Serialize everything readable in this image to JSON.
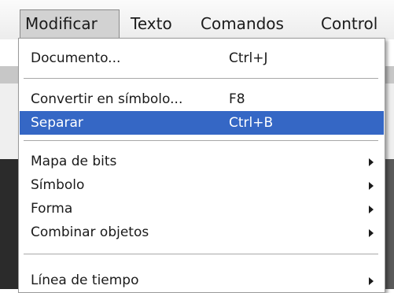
{
  "menubar": {
    "items": [
      {
        "label": "Modificar"
      },
      {
        "label": "Texto"
      },
      {
        "label": "Comandos"
      },
      {
        "label": "Control"
      }
    ]
  },
  "dropdown": {
    "items": [
      {
        "label": "Documento...",
        "shortcut": "Ctrl+J"
      },
      {
        "label": "Convertir en símbolo...",
        "shortcut": "F8"
      },
      {
        "label": "Separar",
        "shortcut": "Ctrl+B"
      },
      {
        "label": "Mapa de bits",
        "submenu_icon": "submenu-arrow-icon"
      },
      {
        "label": "Símbolo",
        "submenu_icon": "submenu-arrow-icon"
      },
      {
        "label": "Forma",
        "submenu_icon": "submenu-arrow-icon"
      },
      {
        "label": "Combinar objetos",
        "submenu_icon": "submenu-arrow-icon"
      },
      {
        "label": "Línea de tiempo",
        "submenu_icon": "submenu-arrow-icon"
      }
    ],
    "highlight_color": "#3567c5"
  }
}
